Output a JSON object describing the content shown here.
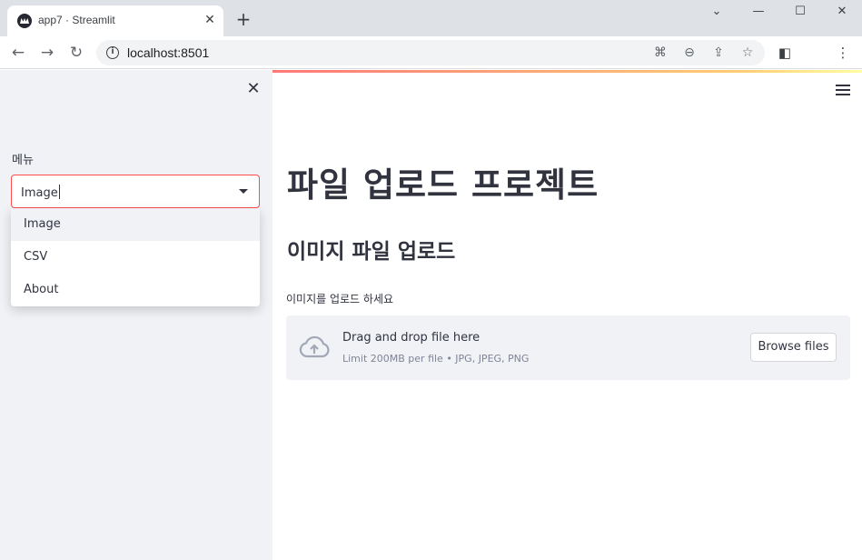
{
  "browser": {
    "tab_title": "app7 · Streamlit",
    "url": "localhost:8501"
  },
  "sidebar": {
    "select_label": "메뉴",
    "select_value": "Image",
    "options": [
      "Image",
      "CSV",
      "About"
    ]
  },
  "main": {
    "title": "파일 업로드 프로젝트",
    "subheader": "이미지 파일 업로드",
    "uploader_label": "이미지를 업로드 하세요",
    "dropzone_title": "Drag and drop file here",
    "dropzone_limit": "Limit 200MB per file • JPG, JPEG, PNG",
    "browse_label": "Browse files"
  },
  "colors": {
    "accent": "#ff4b4b",
    "sidebar_bg": "#f0f2f6",
    "text": "#31333f"
  }
}
